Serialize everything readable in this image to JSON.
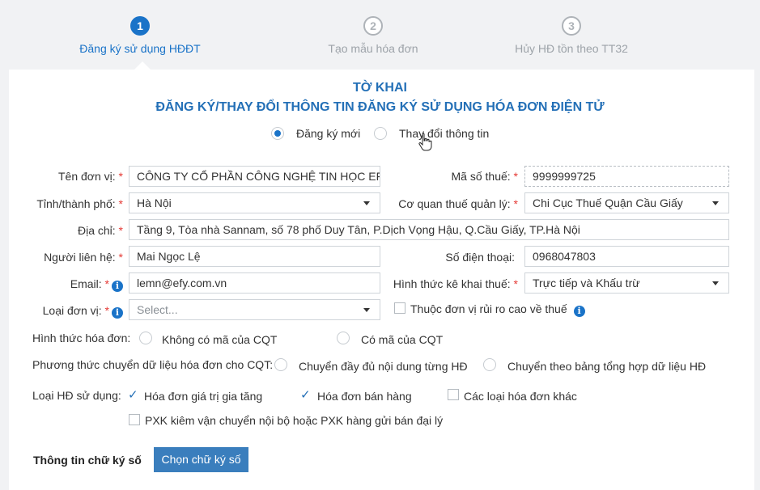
{
  "stepper": {
    "steps": [
      {
        "number": "1",
        "label": "Đăng ký sử dụng HĐĐT"
      },
      {
        "number": "2",
        "label": "Tạo mẫu hóa đơn"
      },
      {
        "number": "3",
        "label": "Hủy HĐ tồn theo TT32"
      }
    ]
  },
  "form": {
    "title": "TỜ KHAI",
    "subtitle": "ĐĂNG KÝ/THAY ĐỔI THÔNG TIN ĐĂNG KÝ SỬ DỤNG HÓA ĐƠN ĐIỆN TỬ",
    "mode": {
      "options": [
        "Đăng ký mới",
        "Thay đổi thông tin"
      ],
      "selected": "Đăng ký mới"
    },
    "fields": {
      "ten_don_vi": {
        "label": "Tên đơn vị:",
        "value": "CÔNG TY CỔ PHẦN CÔNG NGHỆ TIN HỌC EFY"
      },
      "ma_so_thue": {
        "label": "Mã số thuế:",
        "value": "9999999725"
      },
      "tinh_thanh_pho": {
        "label": "Tỉnh/thành phố:",
        "value": "Hà Nội"
      },
      "co_quan_thue": {
        "label": "Cơ quan thuế quản lý:",
        "value": "Chi Cục Thuế Quận Cầu Giấy"
      },
      "dia_chi": {
        "label": "Địa chỉ:",
        "value": "Tầng 9, Tòa nhà Sannam, số 78 phố Duy Tân, P.Dịch Vọng Hậu, Q.Cầu Giấy, TP.Hà Nội"
      },
      "nguoi_lien_he": {
        "label": "Người liên hệ:",
        "value": "Mai Ngọc Lệ"
      },
      "so_dien_thoai": {
        "label": "Số điện thoại:",
        "value": "0968047803"
      },
      "email": {
        "label": "Email:",
        "value": "lemn@efy.com.vn"
      },
      "hinh_thuc_ke_khai": {
        "label": "Hình thức kê khai thuế:",
        "value": "Trực tiếp và Khấu trừ"
      },
      "loai_don_vi": {
        "label": "Loại đơn vị:",
        "placeholder": "Select..."
      },
      "rui_ro_cao": {
        "label": "Thuộc đơn vị rủi ro cao về thuế",
        "checked": false
      }
    },
    "hinh_thuc_hoa_don": {
      "label": "Hình thức hóa đơn:",
      "options": [
        "Không có mã của CQT",
        "Có mã của CQT"
      ]
    },
    "phuong_thuc": {
      "label": "Phương thức chuyển dữ liệu hóa đơn cho CQT:",
      "options": [
        "Chuyển đầy đủ nội dung từng HĐ",
        "Chuyển theo bảng tổng hợp dữ liệu HĐ"
      ]
    },
    "loai_hd": {
      "label": "Loại HĐ sử dụng:",
      "options": [
        {
          "label": "Hóa đơn giá trị gia tăng",
          "checked": true
        },
        {
          "label": "Hóa đơn bán hàng",
          "checked": true
        },
        {
          "label": "Các loại hóa đơn khác",
          "checked": false
        },
        {
          "label": "PXK kiêm vận chuyển nội bộ hoặc PXK hàng gửi bán đại lý",
          "checked": false
        }
      ]
    },
    "chu_ky_so": {
      "label": "Thông tin chữ ký số",
      "button": "Chọn chữ ký số"
    }
  },
  "colors": {
    "accent": "#1a73c8",
    "title": "#2470b7",
    "required": "#e53935"
  }
}
